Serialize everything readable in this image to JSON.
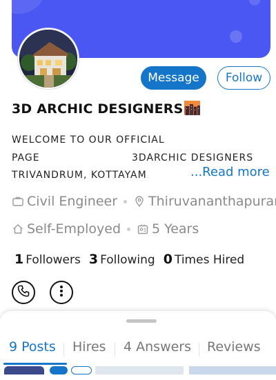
{
  "profile": {
    "name": "3D ARCHIC DESIGNERS",
    "name_emoji_icon": "city-sunset-icon",
    "bio_line1": "WELCOME TO OUR OFFICIAL",
    "bio_line2": "PAGE",
    "bio_line2b": "3DARCHIC DESIGNERS",
    "bio_line3": "TRIVANDRUM, KOTTAYAM",
    "read_more": "...Read more",
    "profession": "Civil Engineer",
    "location": "Thiruvananthapuram",
    "employment": "Self-Employed",
    "experience": "5 Years"
  },
  "actions": {
    "message_label": "Message",
    "follow_label": "Follow"
  },
  "stats": {
    "followers_count": "1",
    "followers_label": "Followers",
    "following_count": "3",
    "following_label": "Following",
    "hired_count": "0",
    "hired_label": "Times Hired"
  },
  "tabs": [
    {
      "label": "9 Posts",
      "active": true
    },
    {
      "label": "Hires",
      "active": false
    },
    {
      "label": "4 Answers",
      "active": false
    },
    {
      "label": "Reviews",
      "active": false
    }
  ],
  "colors": {
    "cover": "#4a57f2",
    "accent": "#1576c9",
    "muted_text": "#8a8a8a"
  }
}
